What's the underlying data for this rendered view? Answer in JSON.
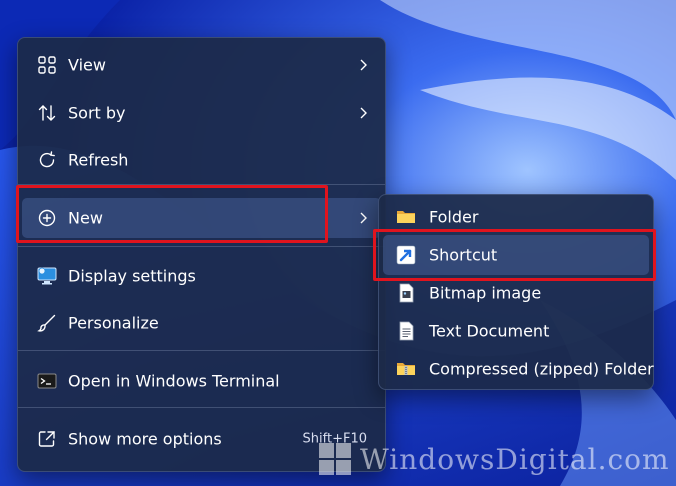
{
  "main_menu": {
    "items": [
      {
        "label": "View",
        "icon": "grid-icon",
        "submenu": true
      },
      {
        "label": "Sort by",
        "icon": "sort-icon",
        "submenu": true
      },
      {
        "label": "Refresh",
        "icon": "refresh-icon",
        "submenu": false
      },
      {
        "label": "New",
        "icon": "plus-circle-icon",
        "submenu": true
      },
      {
        "label": "Display settings",
        "icon": "display-icon",
        "submenu": false
      },
      {
        "label": "Personalize",
        "icon": "brush-icon",
        "submenu": false
      },
      {
        "label": "Open in Windows Terminal",
        "icon": "terminal-icon",
        "submenu": false
      },
      {
        "label": "Show more options",
        "icon": "more-options-icon",
        "submenu": false,
        "shortcut": "Shift+F10"
      }
    ]
  },
  "new_submenu": {
    "items": [
      {
        "label": "Folder",
        "icon": "folder-icon"
      },
      {
        "label": "Shortcut",
        "icon": "shortcut-icon"
      },
      {
        "label": "Bitmap image",
        "icon": "bitmap-icon"
      },
      {
        "label": "Text Document",
        "icon": "text-document-icon"
      },
      {
        "label": "Compressed (zipped) Folder",
        "icon": "zip-folder-icon"
      }
    ]
  },
  "watermark": {
    "text": "WindowsDigital.com"
  },
  "colors": {
    "highlight_box": "#e0141e",
    "menu_bg": "#1c2a48",
    "desktop_bg": "#1536c8"
  }
}
